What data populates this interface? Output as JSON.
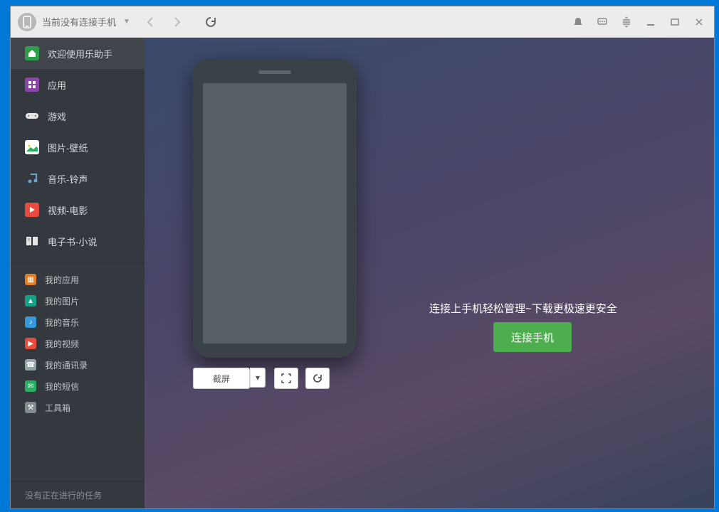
{
  "titlebar": {
    "title": "当前没有连接手机"
  },
  "sidebar": {
    "items": [
      {
        "label": "欢迎使用乐助手"
      },
      {
        "label": "应用"
      },
      {
        "label": "游戏"
      },
      {
        "label": "图片-壁纸"
      },
      {
        "label": "音乐-铃声"
      },
      {
        "label": "视频-电影"
      },
      {
        "label": "电子书-小说"
      }
    ],
    "my_items": [
      {
        "label": "我的应用"
      },
      {
        "label": "我的图片"
      },
      {
        "label": "我的音乐"
      },
      {
        "label": "我的视频"
      },
      {
        "label": "我的通讯录"
      },
      {
        "label": "我的短信"
      },
      {
        "label": "工具箱"
      }
    ],
    "footer": "没有正在进行的任务"
  },
  "main": {
    "message": "连接上手机轻松管理~下载更极速更安全",
    "connect_button": "连接手机",
    "screenshot_button": "截屏"
  }
}
